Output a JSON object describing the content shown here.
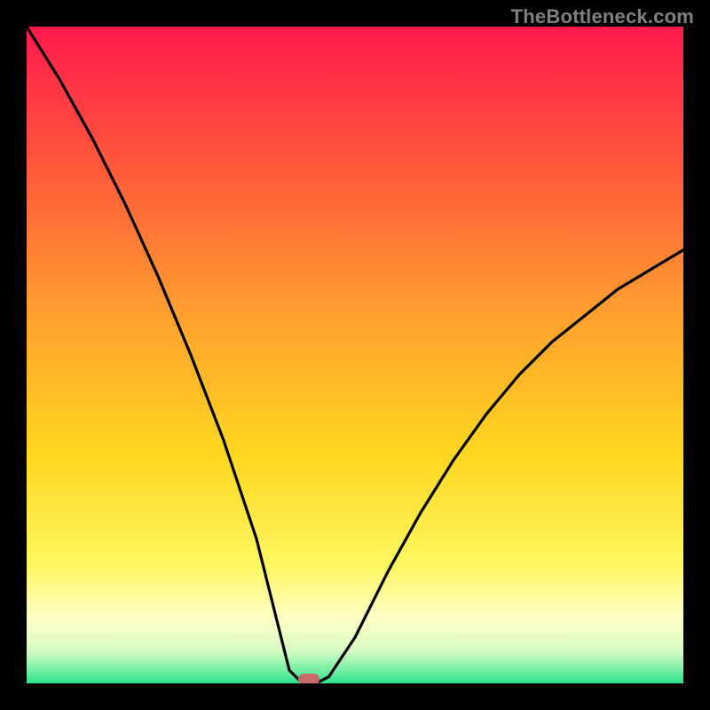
{
  "watermark": "TheBottleneck.com",
  "colors": {
    "bg_black": "#000000",
    "curve": "#000000",
    "marker_fill": "#C96A6A",
    "grad_top": "#FF1A4D",
    "grad_mid_upper": "#FF7F2A",
    "grad_mid": "#FFD500",
    "grad_lower": "#FFFFB0",
    "grad_bottom": "#2EE38B"
  },
  "chart_data": {
    "type": "line",
    "title": "",
    "xlabel": "",
    "ylabel": "",
    "xlim": [
      0,
      100
    ],
    "ylim": [
      0,
      100
    ],
    "series": [
      {
        "name": "bottleneck-curve",
        "x": [
          0,
          5,
          10,
          15,
          20,
          25,
          30,
          35,
          38,
          40,
          42,
          44,
          46,
          50,
          55,
          60,
          65,
          70,
          75,
          80,
          85,
          90,
          95,
          100
        ],
        "y": [
          100,
          92,
          83,
          73,
          62,
          50,
          37,
          22,
          10,
          2,
          0,
          0,
          1,
          7,
          17,
          26,
          34,
          41,
          47,
          52,
          56,
          60,
          63,
          66
        ]
      }
    ],
    "marker": {
      "x": 43,
      "y": 0.5,
      "label": "optimal-point"
    }
  }
}
